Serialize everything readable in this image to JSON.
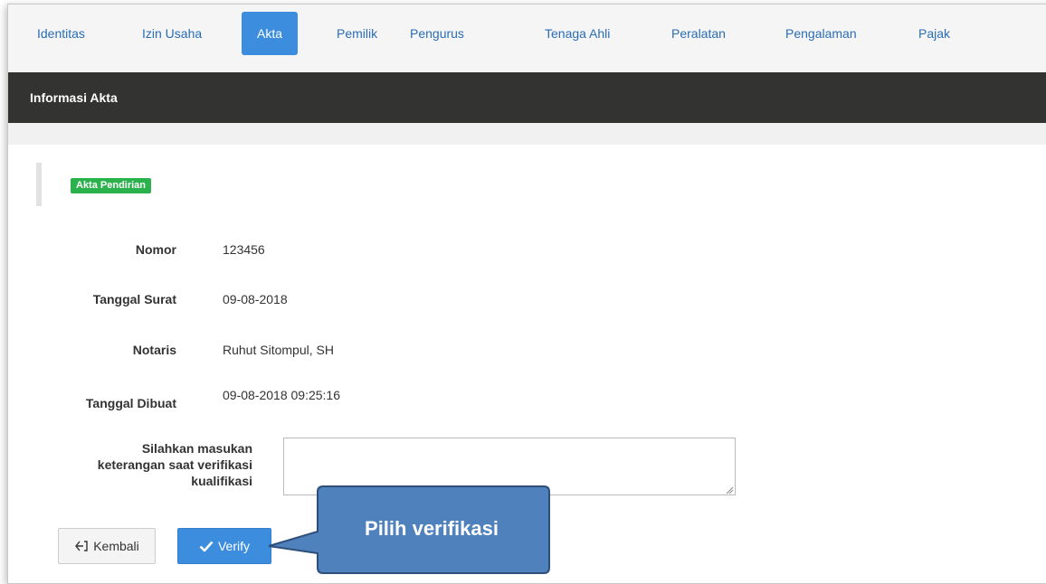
{
  "tabs": [
    {
      "label": "Identitas",
      "active": false
    },
    {
      "label": "Izin Usaha",
      "active": false
    },
    {
      "label": "Akta",
      "active": true
    },
    {
      "label": "Pemilik",
      "active": false
    },
    {
      "label": "Pengurus",
      "active": false
    },
    {
      "label": "Tenaga Ahli",
      "active": false
    },
    {
      "label": "Peralatan",
      "active": false
    },
    {
      "label": "Pengalaman",
      "active": false
    },
    {
      "label": "Pajak",
      "active": false
    }
  ],
  "panel": {
    "title": "Informasi Akta"
  },
  "badge": {
    "label": "Akta Pendirian",
    "color": "#2bb24c"
  },
  "details": {
    "nomor": {
      "label": "Nomor",
      "value": "123456"
    },
    "tanggal_surat": {
      "label": "Tanggal Surat",
      "value": "09-08-2018"
    },
    "notaris": {
      "label": "Notaris",
      "value": "Ruhut Sitompul, SH"
    },
    "tanggal_dibuat": {
      "label": "Tanggal Dibuat",
      "value": "09-08-2018 09:25:16"
    }
  },
  "keterangan": {
    "label_lines": [
      "Silahkan masukan",
      "keterangan saat verifikasi",
      "kualifikasi"
    ],
    "value": "",
    "placeholder": ""
  },
  "buttons": {
    "back": {
      "label": "Kembali",
      "icon": "sign-out-icon"
    },
    "verify": {
      "label": "Verify",
      "icon": "check-icon"
    }
  },
  "callout": {
    "text": "Pilih verifikasi",
    "fill": "#4f81bd",
    "border": "#2e4f7a"
  },
  "colors": {
    "accent": "#3c8dde",
    "header_bg": "#333331",
    "tab_text": "#2a6db5"
  }
}
